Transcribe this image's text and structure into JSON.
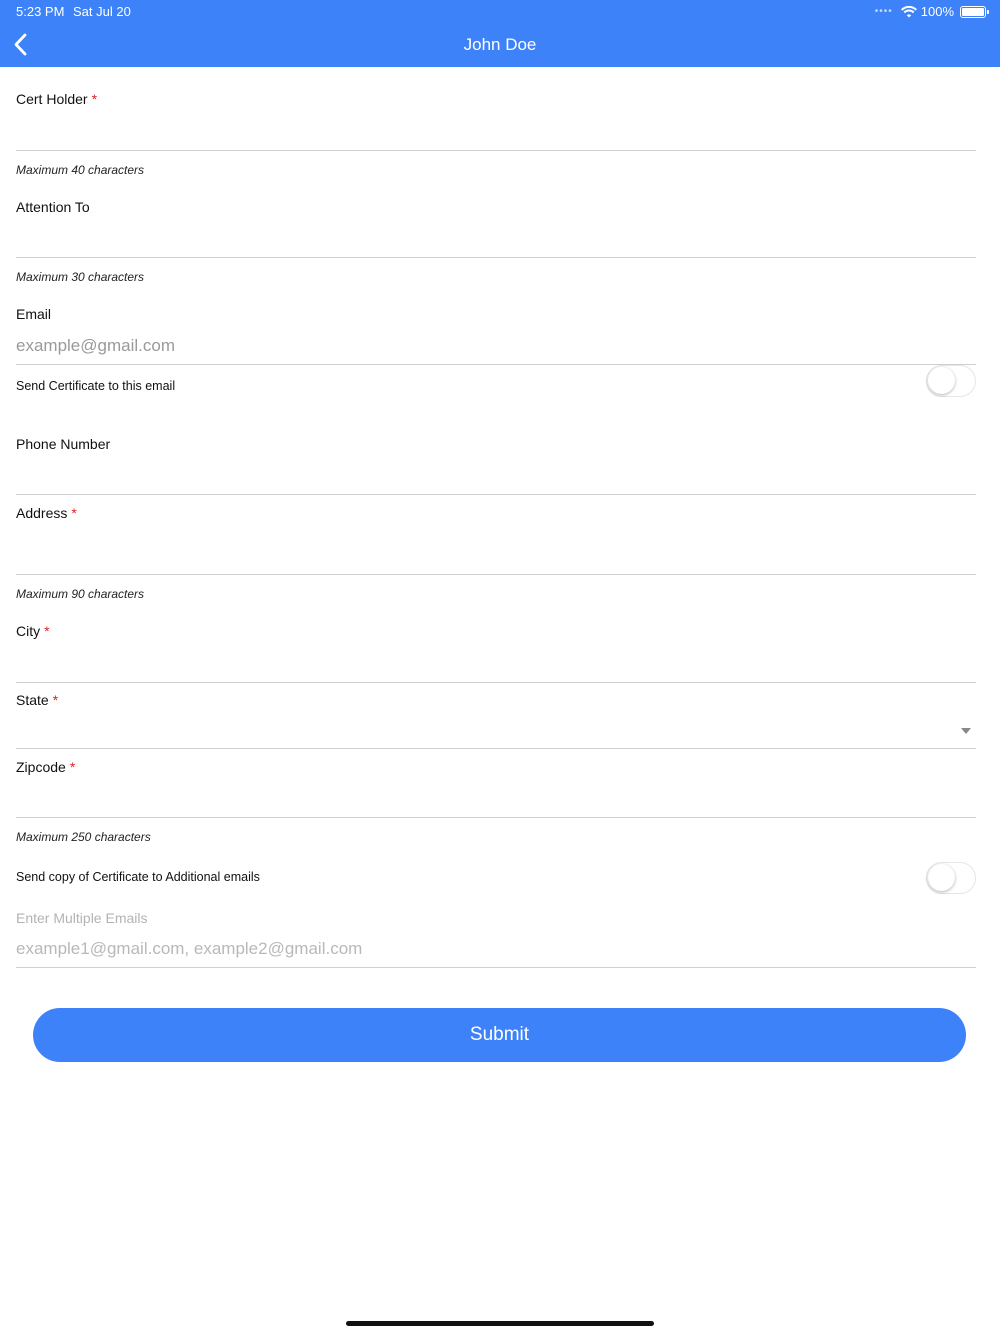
{
  "status_bar": {
    "time": "5:23 PM",
    "date": "Sat Jul 20",
    "battery": "100%",
    "icons": [
      "signal-dots-icon",
      "wifi-icon",
      "battery-icon"
    ]
  },
  "nav": {
    "back_icon": "chevron-left-icon",
    "title": "John Doe"
  },
  "form": {
    "cert_holder": {
      "label": "Cert Holder",
      "required": "*",
      "value": "",
      "hint": "Maximum 40 characters"
    },
    "attention_to": {
      "label": "Attention To",
      "value": "",
      "hint": "Maximum 30 characters"
    },
    "email": {
      "label": "Email",
      "placeholder": "example@gmail.com",
      "value": "",
      "toggle_label": "Send Certificate to this email",
      "toggle_on": false
    },
    "phone": {
      "label": "Phone Number",
      "value": ""
    },
    "address": {
      "label": "Address",
      "required": "*",
      "value": "",
      "hint": "Maximum 90 characters"
    },
    "city": {
      "label": "City",
      "required": "*",
      "value": ""
    },
    "state": {
      "label": "State",
      "required": "*",
      "selected": "",
      "icon": "caret-down-icon"
    },
    "zipcode": {
      "label": "Zipcode",
      "required": "*",
      "value": "",
      "hint": "Maximum 250 characters"
    },
    "additional": {
      "toggle_label": "Send copy of Certificate to Additional emails",
      "toggle_on": false,
      "label": "Enter Multiple Emails",
      "placeholder": "example1@gmail.com, example2@gmail.com",
      "value": ""
    }
  },
  "submit_label": "Submit",
  "colors": {
    "primary": "#3d82f8",
    "required": "#e02020",
    "divider": "#cfcfcf"
  }
}
